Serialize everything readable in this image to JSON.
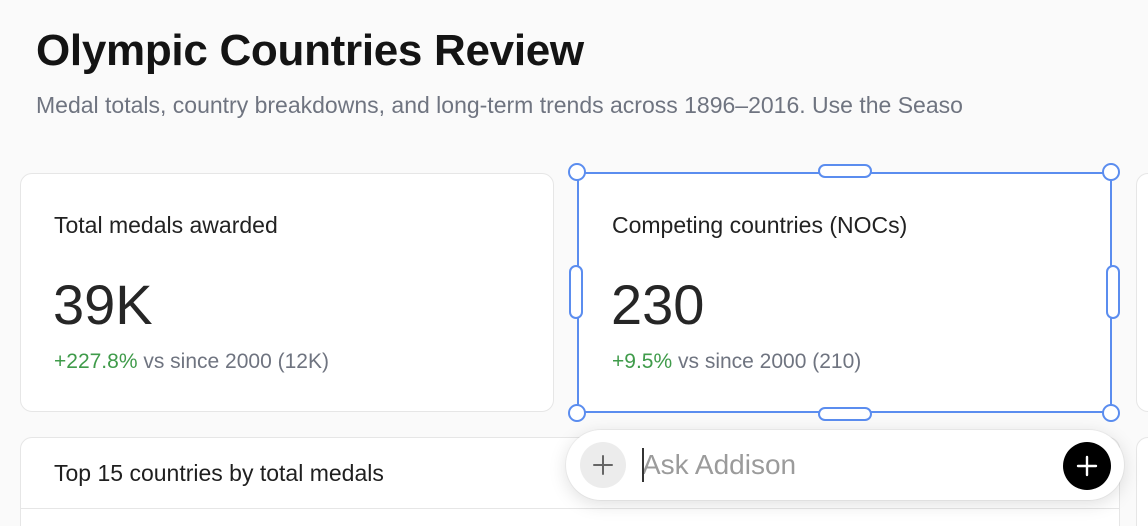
{
  "header": {
    "title": "Olympic Countries Review",
    "subtitle": "Medal totals, country breakdowns, and long-term trends across 1896–2016. Use the Seaso"
  },
  "kpis": [
    {
      "label": "Total medals awarded",
      "value": "39K",
      "delta": "+227.8%",
      "comparison": "vs since 2000 (12K)"
    },
    {
      "label": "Competing countries (NOCs)",
      "value": "230",
      "delta": "+9.5%",
      "comparison": "vs since 2000 (210)"
    }
  ],
  "table": {
    "title": "Top 15 countries by total medals"
  },
  "ask_bar": {
    "placeholder": "Ask Addison",
    "add_icon": "plus-icon",
    "send_icon": "plus-icon"
  },
  "colors": {
    "positive": "#3f9b4a",
    "selection": "#5b8def"
  }
}
